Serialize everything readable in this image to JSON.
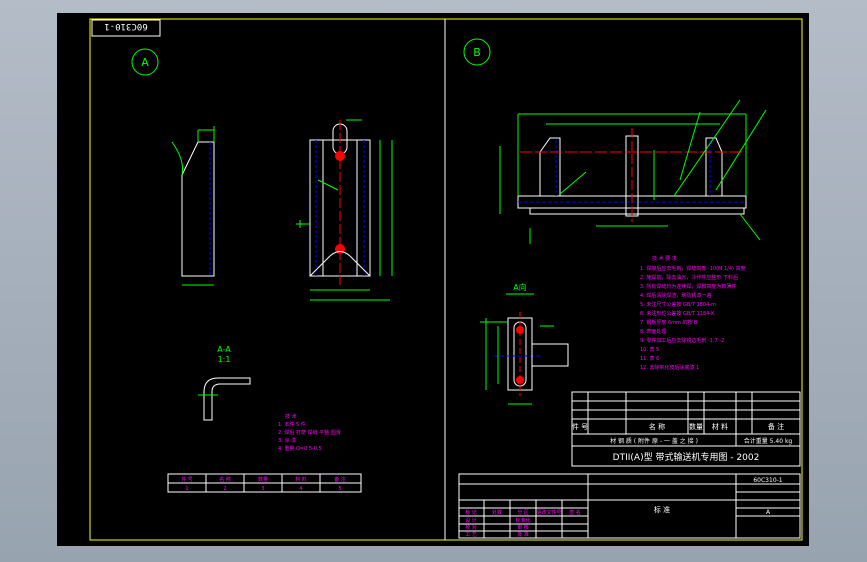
{
  "drawing": {
    "sheet_code": "60C310-1",
    "view_a_label": "A",
    "view_b_label": "B",
    "section_label": "A-A",
    "section_scale": "1:1",
    "direction_label": "A向",
    "title_block": {
      "main_title": "DTII(A)型  带式输送机专用图 - 2002",
      "drawing_no": "60C310-1",
      "material_row": "材  钢  质 (  附件 原 -  一  盖 之 接 )",
      "weight": "合计重量 5.40 kg",
      "header": [
        "件 号",
        "名  称",
        "数量",
        "材 料",
        "备 注"
      ],
      "company": "标 准",
      "rev": "A"
    },
    "notes_right": [
      "技  术  要  求",
      "1. 焊接后应去毛刺，焊缝高度 -10(M 1/4) 高度",
      "2. 施焊前，除去油污，冷作件应整形 下料后",
      "3. 所有焊缝均为连续焊，焊脚高度为较薄件",
      "4. 焊后清除焊渣，刷防锈漆一遍",
      "5. 未注尺寸公差按 GB/T 1804-m",
      "6. 未注形位公差按 GB/T 1184-K",
      "7. 钢板厚度 6mm 的按 B",
      "8. 表面处理",
      "9. 零件加工后应去除锐边毛刺 -1.7 -2",
      "10. 表 5",
      "11. 表 6",
      "12. 去除氧化皮后涂底漆 1"
    ],
    "notes_left": [
      "技  术",
      "1. 本件 5 件",
      "2. 焊后 打磨 焊缝 平整 圆滑",
      "3. 涂 漆",
      "4. 重量 Q=0.5-0.5"
    ],
    "small_table": [
      [
        "件 号",
        "名 称",
        "数量",
        "材 料",
        "备 注"
      ],
      [
        "1",
        "2",
        "3",
        "4",
        "5"
      ]
    ],
    "change_table_rows": [
      [
        "标 记",
        "处数",
        "分 区",
        "更改文件号",
        "签 名"
      ],
      [
        "设 计",
        "",
        "标准化",
        "",
        ""
      ],
      [
        "校 对",
        "",
        "审 核",
        "",
        ""
      ],
      [
        "工 艺",
        "",
        "批 准",
        "",
        ""
      ]
    ]
  }
}
